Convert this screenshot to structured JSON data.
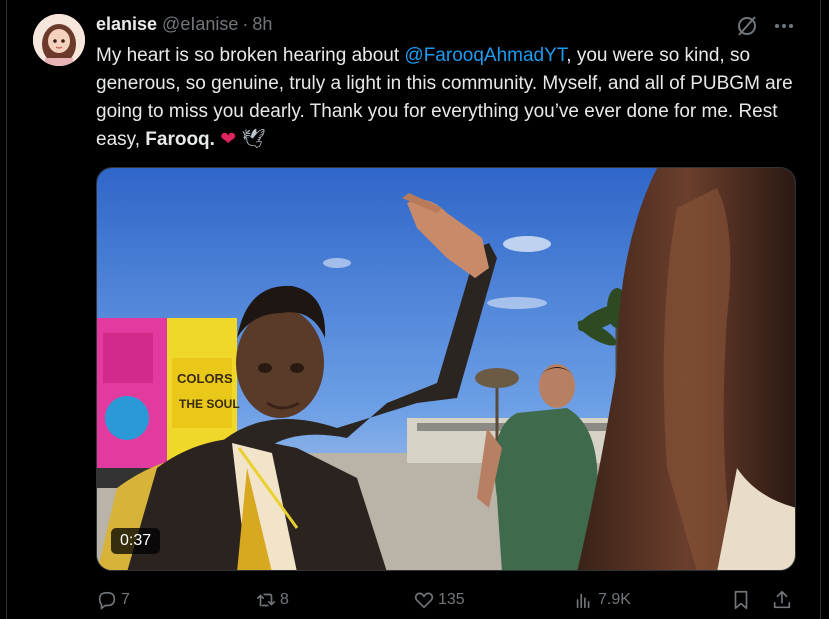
{
  "author": {
    "name": "elanise",
    "handle": "@eIanise",
    "separator": "·",
    "time": "8h"
  },
  "tweet": {
    "text_part1": "My heart is so broken hearing about ",
    "mention": "@FarooqAhmadYT",
    "text_part2": ", you were so kind, so generous, so genuine, truly a light in this community. Myself, and all of PUBGM are going to miss you dearly. Thank you for everything you’ve ever done for me. Rest easy, ",
    "bold_name": "Farooq.",
    "emoji_heart": "❤️",
    "emoji_dove": "🕊️"
  },
  "media": {
    "duration": "0:37",
    "truck_text": "COLORS THE SOUL"
  },
  "actions": {
    "replies": "7",
    "reposts": "8",
    "likes": "135",
    "views": "7.9K"
  },
  "colors": {
    "accent": "#1d9bf0",
    "muted": "#71767b",
    "heart": "#f91880"
  }
}
